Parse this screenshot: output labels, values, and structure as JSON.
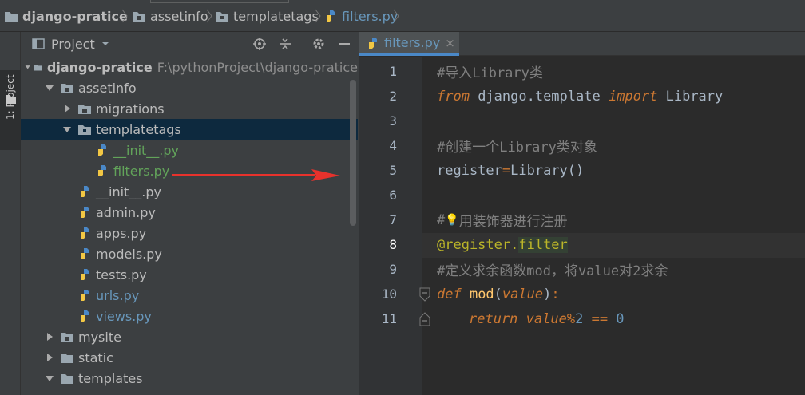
{
  "breadcrumb": {
    "project": "django-pratice",
    "app": "assetinfo",
    "package": "templatetags",
    "file": "filters.py"
  },
  "tool_stripe": {
    "label": "1: Project"
  },
  "project_panel": {
    "title": "Project",
    "root_name": "django-pratice",
    "root_path": "F:\\pythonProject\\django-pratice",
    "items": [
      {
        "label": "assetinfo"
      },
      {
        "label": "migrations"
      },
      {
        "label": "templatetags"
      },
      {
        "label": "__init__.py"
      },
      {
        "label": "filters.py"
      },
      {
        "label": "__init__.py"
      },
      {
        "label": "admin.py"
      },
      {
        "label": "apps.py"
      },
      {
        "label": "models.py"
      },
      {
        "label": "tests.py"
      },
      {
        "label": "urls.py"
      },
      {
        "label": "views.py"
      },
      {
        "label": "mysite"
      },
      {
        "label": "static"
      },
      {
        "label": "templates"
      }
    ]
  },
  "editor": {
    "tab_label": "filters.py",
    "tab_close": "×",
    "line_numbers": [
      "1",
      "2",
      "3",
      "4",
      "5",
      "6",
      "7",
      "8",
      "9",
      "10",
      "11"
    ],
    "code": {
      "l1": "#导入Library类",
      "l2_from": "from",
      "l2_mod": " django.template ",
      "l2_import": "import",
      "l2_lib": " Library",
      "l4": "#创建一个Library类对象",
      "l5_a": "register",
      "l5_b": "=",
      "l5_c": "Library",
      "l5_d": "()",
      "l7_a": "#",
      "l7_bulb": "💡",
      "l7_b": "用装饰器进行注册",
      "l8_a": "@register.",
      "l8_b": "filter",
      "l9": "#定义求余函数mod，将value对2求余",
      "l10_def": "def",
      "l10_name": " mod",
      "l10_p1": "(",
      "l10_param": "value",
      "l10_p2": ")",
      "l10_colon": ":",
      "l11_ret": "return",
      "l11_val": " value",
      "l11_op": "%",
      "l11_two": "2",
      "l11_eq": " == ",
      "l11_zero": "0"
    }
  },
  "colors": {
    "accent": "#4a88c7",
    "selection": "#0d293e",
    "arrow": "#e8322c"
  }
}
